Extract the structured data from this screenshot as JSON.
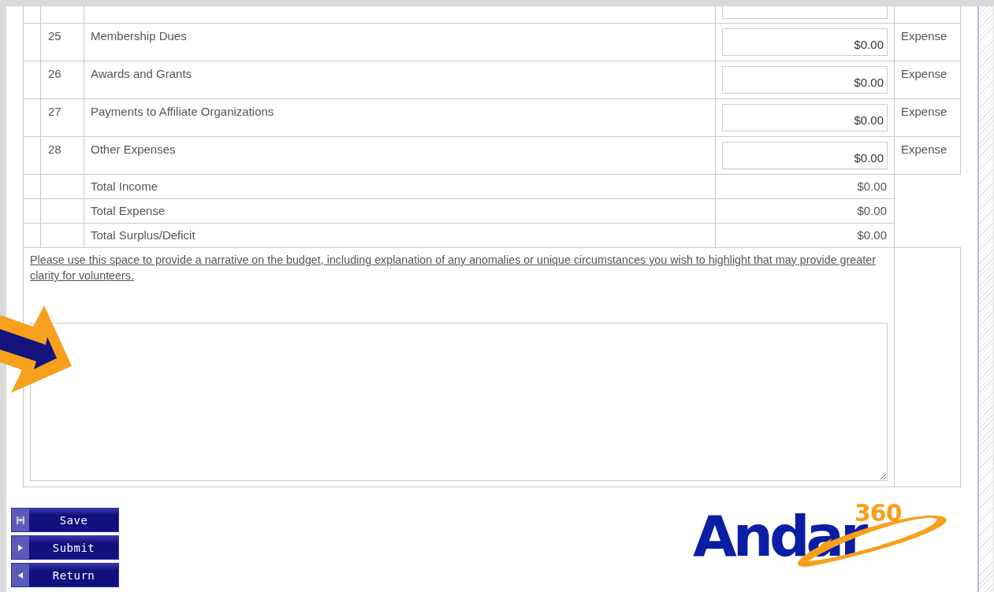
{
  "rows": [
    {
      "number": "25",
      "label": "Membership Dues",
      "amount": "$0.00",
      "type": "Expense"
    },
    {
      "number": "26",
      "label": "Awards and Grants",
      "amount": "$0.00",
      "type": "Expense"
    },
    {
      "number": "27",
      "label": "Payments to Affiliate Organizations",
      "amount": "$0.00",
      "type": "Expense"
    },
    {
      "number": "28",
      "label": "Other Expenses",
      "amount": "$0.00",
      "type": "Expense"
    }
  ],
  "totals": [
    {
      "label": "Total Income",
      "amount": "$0.00"
    },
    {
      "label": "Total Expense",
      "amount": "$0.00"
    },
    {
      "label": "Total Surplus/Deficit",
      "amount": "$0.00"
    }
  ],
  "narrative": {
    "prompt": "Please use this space to provide a narrative on the budget, including explanation of any anomalies or unique circumstances you wish to highlight that may provide greater clarity for volunteers."
  },
  "buttons": [
    {
      "label": "Save",
      "kind": "save"
    },
    {
      "label": "Submit",
      "kind": "forward"
    },
    {
      "label": "Return",
      "kind": "back"
    }
  ],
  "logo": {
    "wordmark": "Andar",
    "superscript": "360"
  }
}
